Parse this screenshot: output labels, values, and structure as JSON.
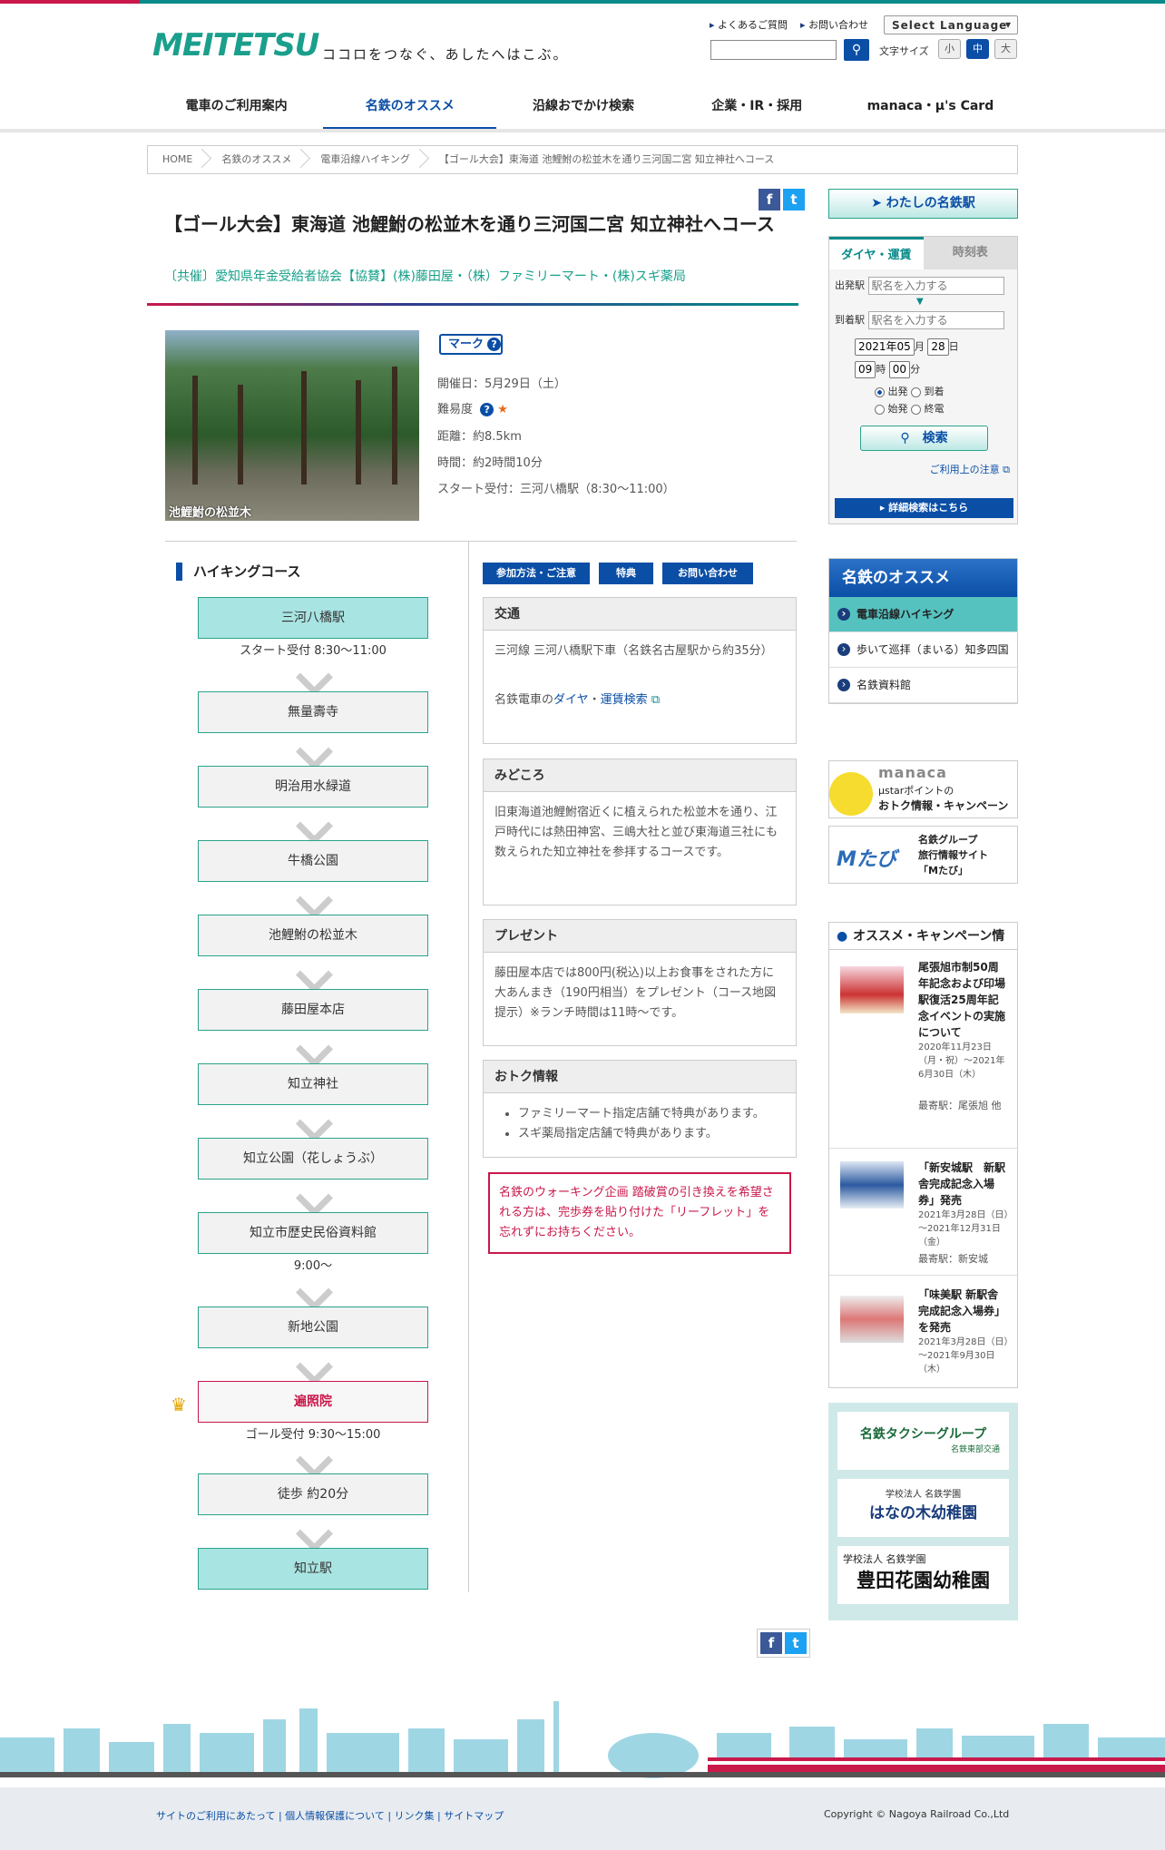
{
  "header": {
    "logo_text": "MEITETSU",
    "tagline": "ココロをつなぐ、あしたへはこぶ。",
    "links": [
      "よくあるご質問",
      "お問い合わせ"
    ],
    "language_select": "Select Language",
    "font_size_label": "文字サイズ",
    "font_sizes": [
      "小",
      "中",
      "大"
    ]
  },
  "nav": [
    "電車のご利用案内",
    "名鉄のオススメ",
    "沿線おでかけ検索",
    "企業・IR・採用",
    "manaca・μ's Card"
  ],
  "breadcrumb": [
    "HOME",
    "名鉄のオススメ",
    "電車沿線ハイキング",
    "【ゴール大会】東海道 池鯉鮒の松並木を通り三河国二宮 知立神社へコース"
  ],
  "page": {
    "title": "【ゴール大会】東海道 池鯉鮒の松並木を通り三河国二宮 知立神社へコース",
    "sponsor": "〔共催〕愛知県年金受給者協会【協賛】(株)藤田屋・（株）ファミリーマート・(株)スギ薬局",
    "photo_caption": "池鯉鮒の松並木",
    "mark_label": "マーク",
    "date": "開催日：5月29日（土）",
    "difficulty_label": "難易度",
    "difficulty_star": "★",
    "distance": "距離：約8.5km",
    "time": "時間：約2時間10分",
    "start": "スタート受付：三河八橋駅（8:30～11:00）"
  },
  "course": {
    "heading": "ハイキングコース",
    "stops": [
      {
        "name": "三河八橋駅",
        "note": "スタート受付 8:30～11:00",
        "type": "end"
      },
      {
        "name": "無量壽寺",
        "note": "",
        "type": "normal"
      },
      {
        "name": "明治用水緑道",
        "note": "",
        "type": "normal"
      },
      {
        "name": "牛橋公園",
        "note": "",
        "type": "normal"
      },
      {
        "name": "池鯉鮒の松並木",
        "note": "",
        "type": "normal"
      },
      {
        "name": "藤田屋本店",
        "note": "",
        "type": "normal"
      },
      {
        "name": "知立神社",
        "note": "",
        "type": "normal"
      },
      {
        "name": "知立公園（花しょうぶ）",
        "note": "",
        "type": "normal"
      },
      {
        "name": "知立市歴史民俗資料館",
        "note": "9:00～",
        "type": "normal"
      },
      {
        "name": "新地公園",
        "note": "",
        "type": "normal"
      },
      {
        "name": "遍照院",
        "note": "ゴール受付 9:30～15:00",
        "type": "goal"
      },
      {
        "name": "徒歩 約20分",
        "note": "",
        "type": "normal"
      },
      {
        "name": "知立駅",
        "note": "",
        "type": "end"
      }
    ]
  },
  "tabs": [
    "参加方法・ご注意",
    "特典",
    "お問い合わせ"
  ],
  "sections": {
    "access_title": "交通",
    "access_text": "三河線 三河八橋駅下車（名鉄名古屋駅から約35分）",
    "access_link_prefix": "名鉄電車の",
    "access_link_1": "ダイヤ",
    "access_link_sep": "・",
    "access_link_2": "運賃検索",
    "highlight_title": "みどころ",
    "highlight_text": "旧東海道池鯉鮒宿近くに植えられた松並木を通り、江戸時代には熱田神宮、三嶋大社と並び東海道三社にも数えられた知立神社を参拝するコースです。",
    "present_title": "プレゼント",
    "present_text": "藤田屋本店では800円(税込)以上お食事をされた方に大あんまき（190円相当）をプレゼント（コース地図提示）※ランチ時間は11時～です。",
    "deal_title": "おトク情報",
    "deals": [
      "ファミリーマート指定店舗で特典があります。",
      "スギ薬局指定店舗で特典があります。"
    ],
    "warning": "名鉄のウォーキング企画 踏破賞の引き換えを希望される方は、完歩券を貼り付けた「リーフレット」を忘れずにお持ちください。"
  },
  "sidebar": {
    "my_meitetsu": "わたしの名鉄駅",
    "widget_tabs": [
      "ダイヤ・運賃",
      "時刻表"
    ],
    "from_label": "出発駅",
    "to_label": "到着駅",
    "station_placeholder": "駅名を入力する",
    "year_month": "2021年05",
    "month_label": "月",
    "day": "28",
    "day_label": "日",
    "hour": "09",
    "hour_label": "時",
    "minute": "00",
    "minute_label": "分",
    "radio_labels": [
      "出発",
      "到着",
      "始発",
      "終電"
    ],
    "search_label": "検索",
    "notice_link": "ご利用上の注意",
    "detail_search": "詳細検索はこちら",
    "recommend_title": "名鉄のオススメ",
    "recommend_items": [
      "電車沿線ハイキング",
      "歩いて巡拝（まいる）知多四国",
      "名鉄資料館"
    ],
    "manaca_banner": [
      "manaca",
      "μstarポイントの",
      "おトク情報・キャンペーン"
    ],
    "mtabi_banner": [
      "名鉄グループ",
      "旅行情報サイト",
      "「Mたび」"
    ],
    "mtabi_logo": "Mたび",
    "campaign_title": "オススメ・キャンペーン情報",
    "campaigns": [
      {
        "title": "尾張旭市制50周年記念および印場駅復活25周年記念イベントの実施について",
        "date": "2020年11月23日（月・祝）～2021年6月30日（木）",
        "station": "最寄駅：尾張旭 他"
      },
      {
        "title": "「新安城駅　新駅舎完成記念入場券」発売",
        "date": "2021年3月28日（日）～2021年12月31日（金）",
        "station": "最寄駅：新安城"
      },
      {
        "title": "「味美駅 新駅舎完成記念入場券」を発売",
        "date": "2021年3月28日（日）～2021年9月30日（木）",
        "station": ""
      }
    ],
    "group_banners": [
      "名鉄タクシーグループ",
      "名鉄東部交通",
      "学校法人 名鉄学園",
      "はなの木幼稚園",
      "学校法人 名鉄学園",
      "豊田花園幼稚園"
    ]
  },
  "footer": {
    "links": [
      "サイトのご利用にあたって",
      "個人情報保護について",
      "リンク集",
      "サイトマップ"
    ],
    "copyright": "Copyright © Nagoya Railroad Co.,Ltd"
  },
  "colors": {
    "brand_teal": "#1a9f8c",
    "brand_blue": "#0a4ea6",
    "accent_red": "#c9184a"
  },
  "icons": [
    "facebook-icon",
    "twitter-icon",
    "search-icon",
    "question-icon",
    "pin-icon",
    "crown-icon",
    "external-link-icon"
  ]
}
